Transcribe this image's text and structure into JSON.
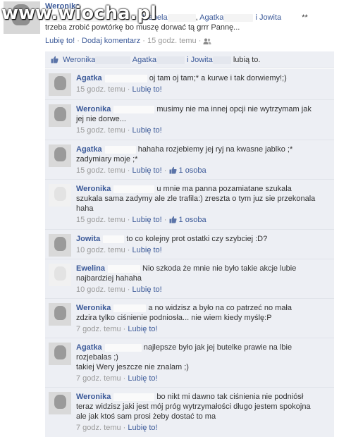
{
  "watermark": {
    "text": "www.wiocha.pl"
  },
  "post": {
    "author": "Weronika",
    "tag_1": "Izabela",
    "tag_2": "Agatka",
    "tag_3": "i Jowita",
    "asterisks": "**",
    "text_line2": "trzeba zrobić powtórkę bo muszę dorwać tą grrr Pannę...",
    "like_link": "Lubię to!",
    "comment_link": "Dodaj komentarz",
    "time": "15 godz. temu",
    "separator": "·"
  },
  "likes": {
    "person_1": "Weronika",
    "person_2": "Agatka",
    "person_3": "i Jowita",
    "suffix": "lubią to."
  },
  "comments": [
    {
      "author": "Agatka",
      "text": "oj tam oj tam;* a kurwe i tak dorwiemy!;)",
      "time": "15 godz. temu",
      "like": "Lubię to!",
      "likes_count": ""
    },
    {
      "author": "Weronika",
      "text": "musimy nie ma innej opcji nie wytrzymam jak",
      "text2": "jej nie dorwe...",
      "time": "15 godz. temu",
      "like": "Lubię to!",
      "likes_count": ""
    },
    {
      "author": "Agatka",
      "text": "hahaha rozjebiemy jej ryj na kwasne jablko ;*",
      "text2": "zadymiary moje ;*",
      "time": "15 godz. temu",
      "like": "Lubię to!",
      "likes_count": "1 osoba"
    },
    {
      "author": "Weronika",
      "text": "u mnie ma panna pozamiatane szukala",
      "text2": "szukala sama zadymy ale zle trafila:) zreszta o tym juz sie przekonala",
      "text3": "haha",
      "time": "15 godz. temu",
      "like": "Lubię to!",
      "likes_count": "1 osoba"
    },
    {
      "author": "Jowita",
      "text": "to co kolejny prot ostatki czy szybciej :D?",
      "time": "10 godz. temu",
      "like": "Lubię to!",
      "likes_count": ""
    },
    {
      "author": "Ewelina",
      "text": "Nio szkoda że mnie nie było takie akcje lubie",
      "text2": "najbardziej hahaha",
      "time": "10 godz. temu",
      "like": "Lubię to!",
      "likes_count": ""
    },
    {
      "author": "Weronika",
      "text": "a no widzisz a było na co patrzeć no mała",
      "text2": "zdzira tylko ciśnienie podniosła... nie wiem kiedy myślę:P",
      "time": "7 godz. temu",
      "like": "Lubię to!",
      "likes_count": ""
    },
    {
      "author": "Agatka",
      "text": "najlepsze było jak jej butelke prawie na lbie",
      "text2": "rozjebalas ;)",
      "text3": "takiej Wery jeszcze nie znalam ;)",
      "time": "7 godz. temu",
      "like": "Lubię to!",
      "likes_count": ""
    },
    {
      "author": "Weronika",
      "text": "bo nikt mi dawno tak ciśnienia nie podniósł",
      "text2": "teraz widzisz jaki jest mój próg wytrzymałości długo jestem spokojna",
      "text3": "ale jak ktoś sam prosi żeby dostać to ma",
      "time": "7 godz. temu",
      "like": "Lubię to!",
      "likes_count": ""
    }
  ],
  "colors": {
    "link": "#3b5998",
    "comment_bg": "#edeff4",
    "meta": "#999999"
  },
  "icons": {
    "like": "thumbs-up-icon",
    "audience": "friends-icon"
  }
}
